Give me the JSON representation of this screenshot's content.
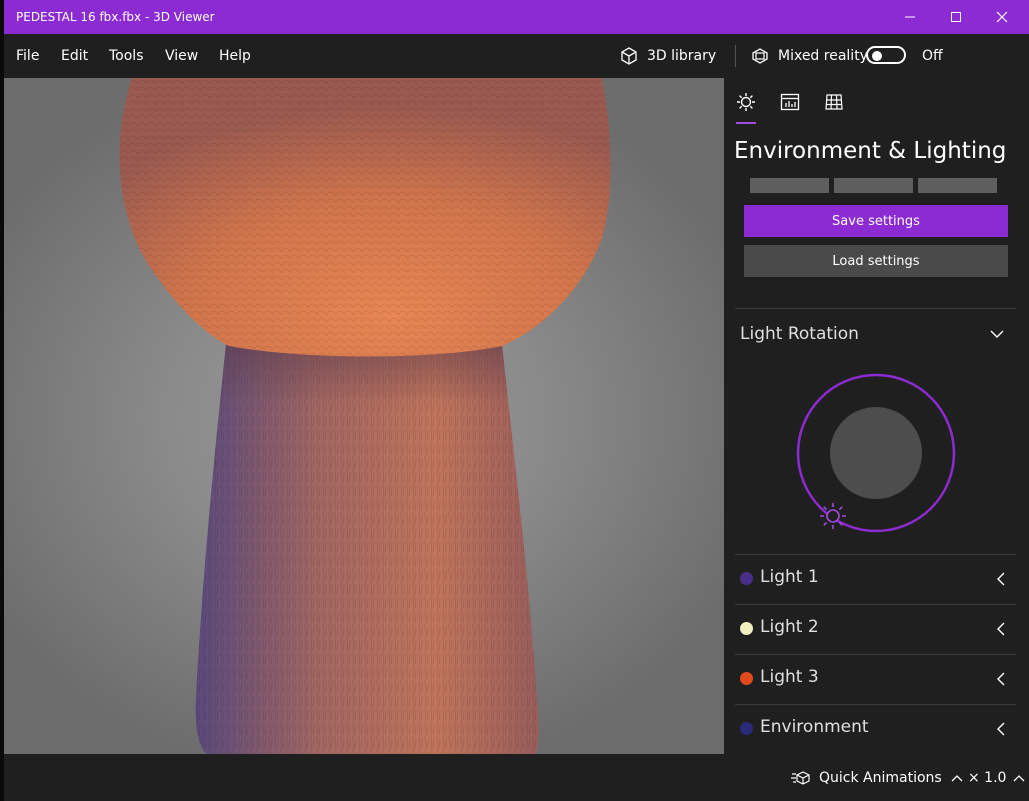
{
  "window": {
    "title": "PEDESTAL 16 fbx.fbx - 3D Viewer"
  },
  "menu": {
    "file": "File",
    "edit": "Edit",
    "tools": "Tools",
    "view": "View",
    "help": "Help"
  },
  "toolbar": {
    "library_label": "3D library",
    "mixed_reality_label": "Mixed reality",
    "mixed_reality_state": "Off",
    "mixed_reality_on": false
  },
  "panel": {
    "title": "Environment & Lighting",
    "save_label": "Save settings",
    "load_label": "Load settings",
    "rotation_title": "Light Rotation",
    "lights": [
      {
        "label": "Light 1",
        "color": "#4a2f8a"
      },
      {
        "label": "Light 2",
        "color": "#f2efc0"
      },
      {
        "label": "Light 3",
        "color": "#e04a1c"
      },
      {
        "label": "Environment",
        "color": "#2a2a7a"
      }
    ]
  },
  "bottom": {
    "quick_animations": "Quick Animations",
    "speed": "× 1.0"
  },
  "colors": {
    "accent": "#8b2bd1",
    "model": "#d9764e"
  }
}
